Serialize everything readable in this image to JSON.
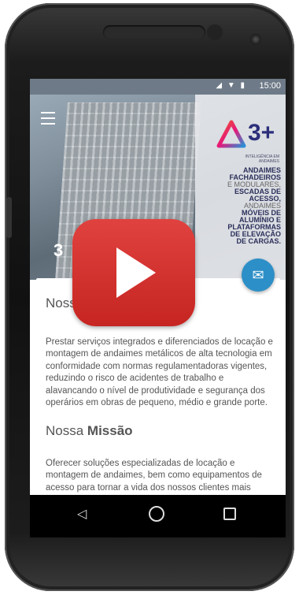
{
  "status": {
    "time": "15:00",
    "icons": "◢ ▼ ▮"
  },
  "hero": {
    "logo_text": "3+",
    "logo_sub": "INTELIGÊNCIA EM ANDAIMES",
    "tagline_lines": [
      "ANDAIMES",
      "FACHADEIROS",
      "E MODULARES,",
      "ESCADAS DE",
      "ACESSO,",
      "ANDAIMES",
      "MÓVEIS DE",
      "ALUMÍNIO E",
      "PLATAFORMAS",
      "DE ELEVAÇÃO",
      "DE CARGAS."
    ],
    "overlay_number": "3"
  },
  "content": {
    "vision_title": "Nossa Visão",
    "vision_text": "Prestar serviços integrados e diferenciados de locação e montagem de andaimes metálicos de alta tecnologia em conformidade com normas regulamentadoras  vigentes, reduzindo o risco de acidentes de trabalho e alavancando o nível de produtividade e segurança dos operários em obras de pequeno, médio e grande porte.",
    "mission_title_a": "Nossa ",
    "mission_title_b": "Missão",
    "mission_text": "Oferecer soluções especializadas de locação e montagem de andaimes, bem como equipamentos de acesso para tornar a vida dos nossos clientes mais simples, mais conveniente,"
  },
  "nav": {
    "back": "◁"
  },
  "colors": {
    "accent": "#2d8fc7",
    "play": "#d8322f"
  }
}
